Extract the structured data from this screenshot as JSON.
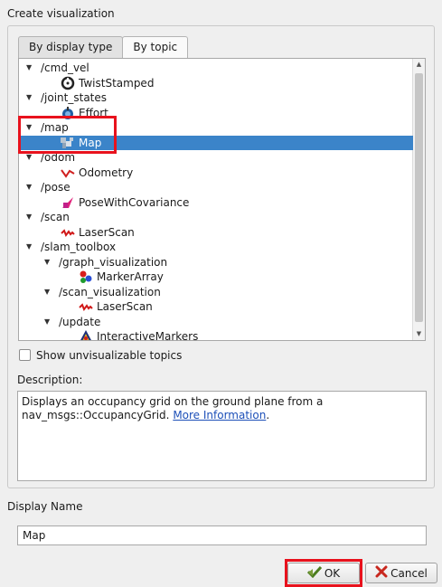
{
  "group": {
    "title": "Create visualization"
  },
  "tabs": [
    {
      "label": "By display type"
    },
    {
      "label": "By topic"
    }
  ],
  "tree": {
    "rows": [
      {
        "text": "/cmd_vel",
        "kind": "topic"
      },
      {
        "text": "TwistStamped",
        "kind": "display",
        "icon": "twist-icon"
      },
      {
        "text": "/joint_states",
        "kind": "topic"
      },
      {
        "text": "Effort",
        "kind": "display",
        "icon": "effort-icon"
      },
      {
        "text": "/map",
        "kind": "topic"
      },
      {
        "text": "Map",
        "kind": "display",
        "icon": "map-icon",
        "selected": true
      },
      {
        "text": "/odom",
        "kind": "topic"
      },
      {
        "text": "Odometry",
        "kind": "display",
        "icon": "odometry-icon"
      },
      {
        "text": "/pose",
        "kind": "topic"
      },
      {
        "text": "PoseWithCovariance",
        "kind": "display",
        "icon": "pose-icon"
      },
      {
        "text": "/scan",
        "kind": "topic"
      },
      {
        "text": "LaserScan",
        "kind": "display",
        "icon": "laserscan-icon"
      },
      {
        "text": "/slam_toolbox",
        "kind": "topic"
      },
      {
        "text": "/graph_visualization",
        "kind": "subtopic"
      },
      {
        "text": "MarkerArray",
        "kind": "subdisplay",
        "icon": "marker-array-icon"
      },
      {
        "text": "/scan_visualization",
        "kind": "subtopic"
      },
      {
        "text": "LaserScan",
        "kind": "subdisplay",
        "icon": "laserscan-icon"
      },
      {
        "text": "/update",
        "kind": "subtopic"
      },
      {
        "text": "InteractiveMarkers",
        "kind": "subdisplay",
        "icon": "interactive-markers-icon"
      }
    ]
  },
  "checkbox": {
    "label": "Show unvisualizable topics",
    "checked": false
  },
  "description": {
    "label": "Description:",
    "text_line1": "Displays an occupancy grid on the ground plane from a",
    "text_line2": "nav_msgs::OccupancyGrid.",
    "link": "More Information",
    "after_link": "."
  },
  "display_name": {
    "label": "Display Name",
    "value": "Map"
  },
  "buttons": {
    "ok": "OK",
    "cancel": "Cancel"
  },
  "colors": {
    "selection": "#3b84c9",
    "highlight_box": "#e8121d",
    "link": "#1c4fb8"
  }
}
